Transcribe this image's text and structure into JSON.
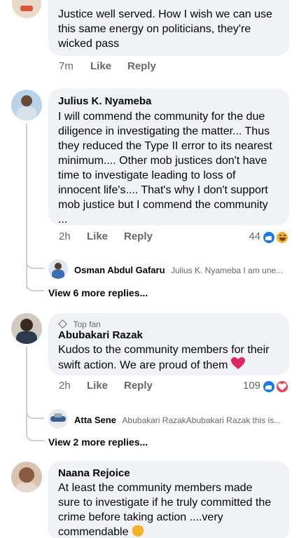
{
  "comments": [
    {
      "text": "Justice well served. How I wish we can use\nthis same energy on politicians, they're\nwicked pass",
      "time": "7m",
      "like": "Like",
      "reply": "Reply"
    },
    {
      "author": "Julius K. Nyameba",
      "text": "I will commend the community for the due\ndiligence in investigating the matter... Thus\nthey reduced the Type II error to its nearest\nminimum.... Other mob justices don't have\ntime to investigate leading to loss of\ninnocent life's.... That's why I don't support\nmob justice but I commend the community\n...",
      "time": "2h",
      "like": "Like",
      "reply": "Reply",
      "reaction_count": "44",
      "reply_preview": {
        "author": "Osman Abdul Gafaru",
        "text": "Julius K. Nyameba I am une..."
      },
      "view_more": "View 6 more replies..."
    },
    {
      "badge": "Top fan",
      "author": "Abubakari Razak",
      "text": "Kudos to the community members for their\nswift action. We are proud of them",
      "time": "2h",
      "like": "Like",
      "reply": "Reply",
      "reaction_count": "109",
      "reply_preview": {
        "author": "Atta Sene",
        "text": "Abubakari RazakAbubakari Razak this is..."
      },
      "view_more": "View 2 more replies..."
    },
    {
      "author": "Naana Rejoice",
      "text": "At least the community members made\nsure to investigate if he truly committed the\ncrime before taking action ....very\ncommendable"
    }
  ],
  "colors": {
    "bubble": "#f0f2f5",
    "like_blue": "#1877f2",
    "love_red": "#f33e58",
    "haha_yellow": "#f7b125"
  }
}
